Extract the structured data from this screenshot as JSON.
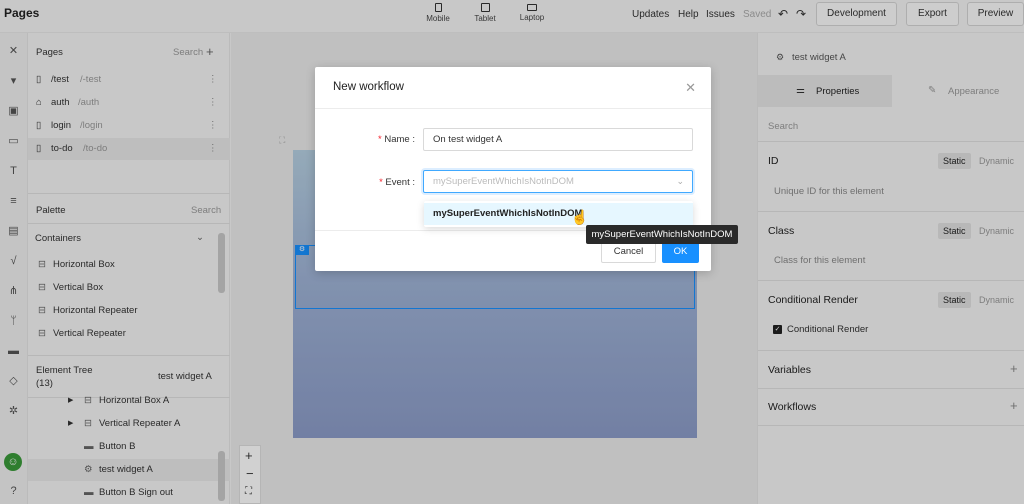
{
  "topbar": {
    "title": "Pages",
    "devices": [
      "Mobile",
      "Tablet",
      "Laptop"
    ],
    "links": [
      "Updates",
      "Help",
      "Issues"
    ],
    "saved": "Saved",
    "undo_icon": "undo-icon",
    "redo_icon": "redo-icon",
    "buttons": [
      "Development",
      "Export",
      "Preview"
    ]
  },
  "pages_panel": {
    "title": "Pages",
    "search": "Search",
    "items": [
      {
        "name": "/test",
        "path": "/-test",
        "icon": "file-icon"
      },
      {
        "name": "auth",
        "path": "/auth",
        "icon": "home-icon"
      },
      {
        "name": "login",
        "path": "/login",
        "icon": "file-icon"
      },
      {
        "name": "to-do",
        "path": "/to-do",
        "icon": "file-icon"
      }
    ]
  },
  "palette": {
    "title": "Palette",
    "search": "Search",
    "group": "Containers",
    "items": [
      "Horizontal Box",
      "Vertical Box",
      "Horizontal Repeater",
      "Vertical Repeater"
    ]
  },
  "element_tree": {
    "title": "Element Tree",
    "count": "(13)",
    "selected": "test widget A",
    "items": [
      "Horizontal Box A",
      "Vertical Repeater A",
      "Button B",
      "test widget A",
      "Button B Sign out"
    ]
  },
  "right_panel": {
    "widget": "test widget A",
    "tabs": [
      "Properties",
      "Appearance"
    ],
    "search": "Search",
    "sections": [
      {
        "title": "ID",
        "on": "Static",
        "off": "Dynamic",
        "hint": "Unique ID for this element"
      },
      {
        "title": "Class",
        "on": "Static",
        "off": "Dynamic",
        "hint": "Class for this element"
      },
      {
        "title": "Conditional Render",
        "on": "Static",
        "off": "Dynamic",
        "checkbox": "Conditional Render"
      }
    ],
    "variables": "Variables",
    "workflows": "Workflows"
  },
  "modal": {
    "title": "New workflow",
    "name_label": "Name",
    "name_value": "On test widget A",
    "event_label": "Event",
    "event_placeholder": "mySuperEventWhichIsNotInDOM",
    "option": "mySuperEventWhichIsNotInDOM",
    "tooltip": "mySuperEventWhichIsNotInDOM",
    "cancel": "Cancel",
    "ok": "OK",
    "required_mark": "*",
    "colon": ":"
  },
  "colors": {
    "primary": "#1890ff",
    "required": "#f5222d"
  }
}
